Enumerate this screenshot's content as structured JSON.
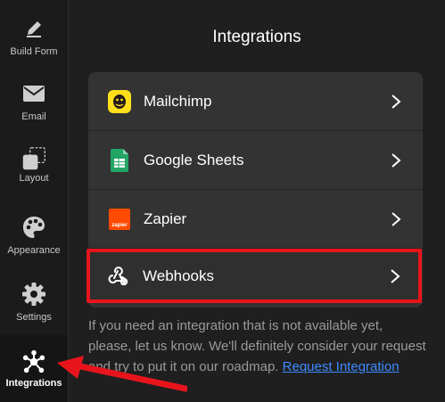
{
  "sidebar": {
    "items": [
      {
        "label": "Build Form",
        "icon": "pencil-icon"
      },
      {
        "label": "Email",
        "icon": "envelope-icon"
      },
      {
        "label": "Layout",
        "icon": "layout-icon"
      },
      {
        "label": "Appearance",
        "icon": "palette-icon"
      },
      {
        "label": "Settings",
        "icon": "gear-icon"
      },
      {
        "label": "Integrations",
        "icon": "integrations-hub-icon",
        "active": true
      }
    ]
  },
  "main": {
    "title": "Integrations",
    "integrations": [
      {
        "label": "Mailchimp",
        "icon": "mailchimp-icon"
      },
      {
        "label": "Google Sheets",
        "icon": "google-sheets-icon"
      },
      {
        "label": "Zapier",
        "icon": "zapier-icon"
      },
      {
        "label": "Webhooks",
        "icon": "webhooks-icon",
        "highlighted": true
      }
    ],
    "help_text": "If you need an integration that is not available yet, please, let us know. We'll definitely consider your request and try to put it on our roadmap.",
    "help_link": "Request Integration",
    "zapier_logo_text": "zapier"
  },
  "colors": {
    "highlight": "#e8141c",
    "link": "#3d8bff",
    "mailchimp": "#ffe01b",
    "sheets": "#23a566",
    "zapier": "#ff4a00"
  }
}
